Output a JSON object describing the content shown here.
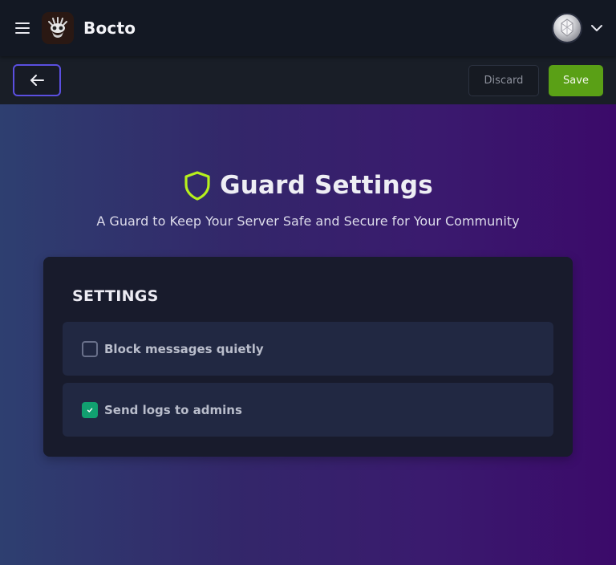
{
  "app": {
    "title": "Bocto"
  },
  "icons": {
    "menu": "hamburger-menu-icon",
    "logo": "bocto-logo-icon",
    "avatar": "user-avatar",
    "account_menu": "chevron-down-icon",
    "back": "arrow-left-icon",
    "heading": "shield-icon",
    "checked": "check-icon"
  },
  "toolbar": {
    "discard_label": "Discard",
    "save_label": "Save"
  },
  "page": {
    "title": "Guard Settings",
    "subtitle": "A Guard to Keep Your Server Safe and Secure for Your Community"
  },
  "settings": {
    "section_title": "SETTINGS",
    "options": [
      {
        "label": "Block messages quietly",
        "checked": false
      },
      {
        "label": "Send logs to admins",
        "checked": true
      }
    ]
  },
  "colors": {
    "accent_save": "#5aa016",
    "accent_back_border": "#5b4fe0",
    "shield": "#b6f01c",
    "checkbox_checked": "#11a070"
  }
}
